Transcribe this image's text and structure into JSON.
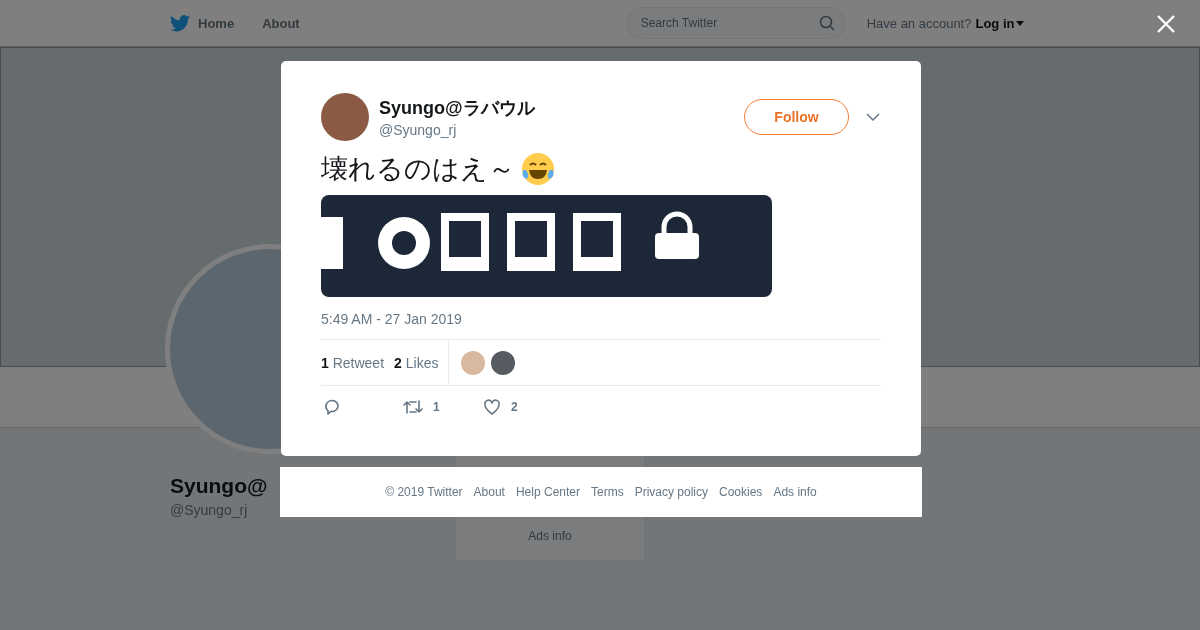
{
  "nav": {
    "items": [
      {
        "label": "Home"
      },
      {
        "label": "About"
      }
    ],
    "search": {
      "placeholder": "Search Twitter"
    },
    "account_prompt": "Have an account?",
    "login": "Log in"
  },
  "profile": {
    "name": "Syungo@",
    "handle": "@Syungo_rj"
  },
  "background_footer": {
    "lines": [
      "Ads info"
    ]
  },
  "tweet": {
    "name": "Syungo@ラバウル",
    "handle": "@Syungo_rj",
    "follow_button": "Follow",
    "text": "壊れるのはえ～",
    "timestamp": "5:49 AM - 27 Jan 2019",
    "stats": [
      {
        "count": "1",
        "label": "Retweet"
      },
      {
        "count": "2",
        "label": "Likes"
      }
    ],
    "liked_by": [
      {
        "kind": "avatar"
      },
      {
        "kind": "avatar"
      }
    ],
    "actions": [
      {
        "kind": "reply"
      },
      {
        "kind": "retweet",
        "count": "1"
      },
      {
        "kind": "like",
        "count": "2"
      }
    ]
  },
  "footer": {
    "links": [
      "© 2019 Twitter",
      "About",
      "Help Center",
      "Terms",
      "Privacy policy",
      "Cookies",
      "Ads info"
    ]
  }
}
